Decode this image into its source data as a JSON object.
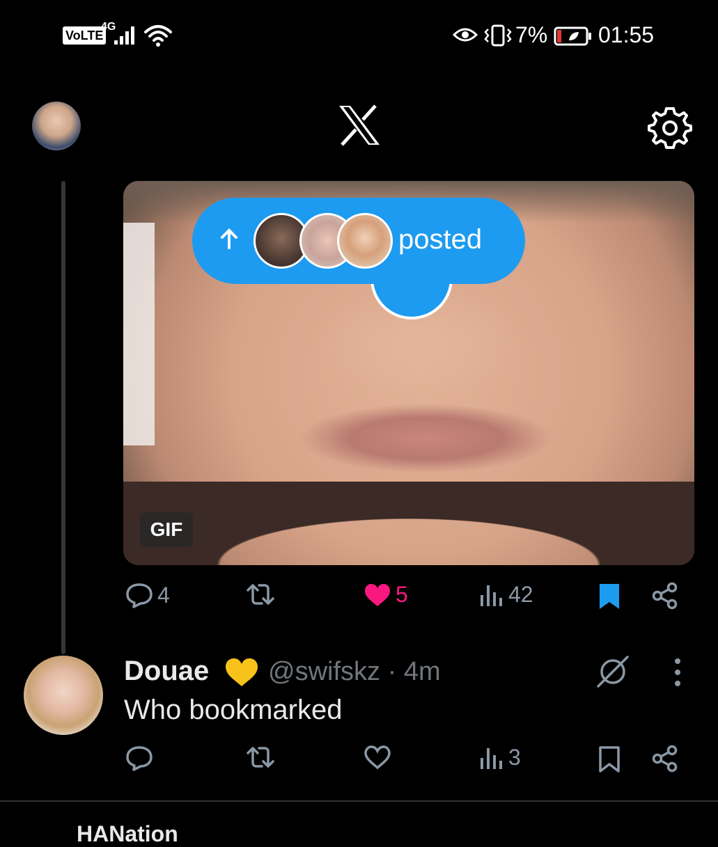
{
  "status_bar": {
    "volte": "VoLTE",
    "network": "4G",
    "battery_percent": "7%",
    "time": "01:55"
  },
  "colors": {
    "accent": "#1d9bf0",
    "like": "#f91880",
    "muted": "#71767b"
  },
  "media_post": {
    "gif_badge": "GIF",
    "new_posts_pill": "posted",
    "actions": {
      "replies": "4",
      "retweets": "",
      "likes": "5",
      "views": "42",
      "liked": true,
      "bookmarked": true
    }
  },
  "reply_post": {
    "display_name": "Douae",
    "name_emoji": "yellow-heart",
    "handle": "@swifskz",
    "separator": "·",
    "time_ago": "4m",
    "text": "Who bookmarked",
    "actions": {
      "replies": "",
      "retweets": "",
      "likes": "",
      "views": "3",
      "liked": false,
      "bookmarked": false
    }
  },
  "next_post_peek": "HANation"
}
